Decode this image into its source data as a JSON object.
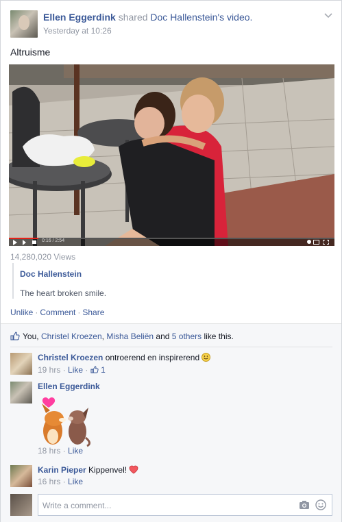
{
  "post": {
    "author": "Ellen Eggerdink",
    "action": "shared",
    "shared_from": "Doc Hallenstein",
    "shared_suffix": "'s",
    "object": "video.",
    "timestamp": "Yesterday at 10:26",
    "text": "Altruisme"
  },
  "video": {
    "time_display": "0:16 / 2:54",
    "views": "14,280,020 Views"
  },
  "quote": {
    "name": "Doc Hallenstein",
    "text": "The heart broken smile."
  },
  "actions": {
    "unlike": "Unlike",
    "comment": "Comment",
    "share": "Share"
  },
  "likes": {
    "you": "You,",
    "person1": "Christel Kroezen",
    "sep": ",",
    "person2": "Misha Beliën",
    "and": "and",
    "others": "5 others",
    "suffix": "like this."
  },
  "comments": [
    {
      "name": "Christel Kroezen",
      "text": "ontroerend en inspirerend",
      "time": "19 hrs",
      "like": "Like",
      "like_count": "1"
    },
    {
      "name": "Ellen Eggerdink",
      "time": "18 hrs",
      "like": "Like"
    },
    {
      "name": "Karin Pieper",
      "text": "Kippenvel!",
      "time": "16 hrs",
      "like": "Like"
    }
  ],
  "composer": {
    "placeholder": "Write a comment..."
  },
  "colors": {
    "link": "#3b5998",
    "meta": "#9197a3",
    "progress": "#e62117"
  }
}
